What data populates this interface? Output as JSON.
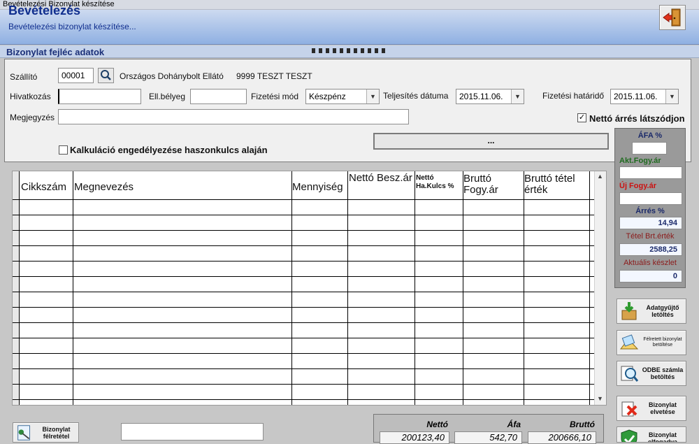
{
  "window_title": "Bevételezési Bizonylat készítése",
  "header": {
    "title": "Bevételezés",
    "subtitle": "Bevételezési bizonylat készítése..."
  },
  "section_title": "Bizonylat fejléc adatok",
  "form": {
    "supplier_label": "Szállító",
    "supplier_code": "00001",
    "supplier_name": "Országos Dohánybolt Ellátó",
    "supplier_extra": "9999 TESZT TESZT",
    "reference_label": "Hivatkozás",
    "reference_value": "",
    "stamp_label": "Ell.bélyeg",
    "stamp_value": "",
    "payment_label": "Fizetési mód",
    "payment_value": "Készpénz",
    "completion_label": "Teljesítés dátuma",
    "completion_value": "2015.11.06.",
    "deadline_label": "Fizetési határidő",
    "deadline_value": "2015.11.06.",
    "note_label": "Megjegyzés",
    "note_value": "",
    "net_margin_label": "Nettó árrés látszódjon",
    "net_margin_checked": true,
    "calc_label": "Kalkuláció engedélyezése haszonkulcs alaján",
    "calc_checked": false,
    "dots_label": "..."
  },
  "grid": {
    "columns": [
      "Cikkszám",
      "Megnevezés",
      "Mennyiség",
      "Nettó Besz.ár",
      "Nettó Ha.Kulcs %",
      "Bruttó Fogy.ár",
      "Bruttó tétel érték"
    ],
    "rows": []
  },
  "side_panel": {
    "afa_label": "ÁFA %",
    "afa_value": "",
    "akt_label": "Akt.Fogy.ár",
    "akt_value": "",
    "uj_label": "Új Fogy.ár",
    "uj_value": "",
    "arres_label": "Árrés %",
    "arres_value": "14,94",
    "tetel_label": "Tétel Brt.érték",
    "tetel_value": "2588,25",
    "keszlet_label": "Aktuális készlet",
    "keszlet_value": "0",
    "colors": {
      "dark_blue": "#1b2a6a",
      "green": "#1f6b1f",
      "red": "#cc1111",
      "maroon": "#8b1a1a"
    }
  },
  "actions": {
    "adatgyujto": "Adatgyűjtő letöltés",
    "felretett": "Félretett bizonylat betöltése",
    "odbe": "ODBE számla betöltés",
    "elvetese": "Bizonylat elvetése",
    "elfogadva": "Bizonylat elfogadva",
    "felretetel": "Bizonylat félretétel"
  },
  "totals": {
    "net_label": "Nettó",
    "net_value": "200123,40",
    "vat_label": "Áfa",
    "vat_value": "542,70",
    "gross_label": "Bruttó",
    "gross_value": "200666,10"
  }
}
